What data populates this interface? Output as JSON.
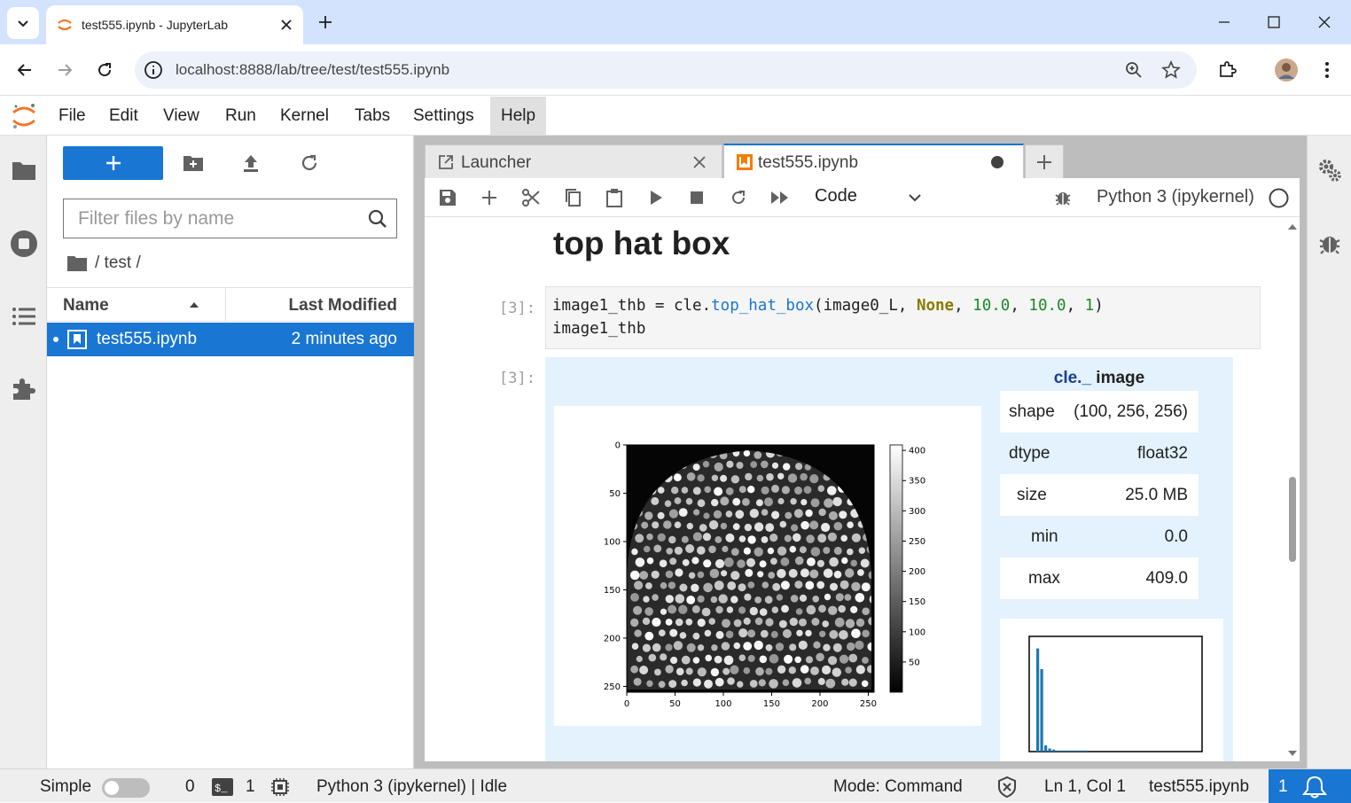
{
  "browser": {
    "tab_title": "test555.ipynb - JupyterLab",
    "url": "localhost:8888/lab/tree/test/test555.ipynb"
  },
  "menubar": {
    "items": [
      "File",
      "Edit",
      "View",
      "Run",
      "Kernel",
      "Tabs",
      "Settings",
      "Help"
    ],
    "active": "Help"
  },
  "filebrowser": {
    "filter_placeholder": "Filter files by name",
    "breadcrumb": "/ test /",
    "col_name": "Name",
    "col_modified": "Last Modified",
    "files": [
      {
        "name": "test555.ipynb",
        "modified": "2 minutes ago",
        "selected": true
      }
    ]
  },
  "dock": {
    "tabs": [
      {
        "label": "Launcher",
        "current": false
      },
      {
        "label": "test555.ipynb",
        "current": true
      }
    ]
  },
  "notebook": {
    "cell_type": "Code",
    "kernel": "Python 3 (ipykernel)",
    "heading": "top hat box",
    "input_prompt": "[3]:",
    "output_prompt": "[3]:",
    "code_line1": {
      "var": "image1_thb",
      "eq": " = ",
      "obj": "cle.",
      "fn": "top_hat_box",
      "open": "(image0_L, ",
      "kw": "None",
      "sep1": ", ",
      "n1": "10.0",
      "sep2": ", ",
      "n2": "10.0",
      "sep3": ", ",
      "n3": "1",
      "close": ")"
    },
    "code_line2": "image1_thb",
    "info_title_brand": "cle._",
    "info_title_rest": " image",
    "info": [
      {
        "key": "shape",
        "value": "(100, 256, 256)"
      },
      {
        "key": "dtype",
        "value": "float32"
      },
      {
        "key": "size",
        "value": "25.0 MB"
      },
      {
        "key": "min",
        "value": "0.0"
      },
      {
        "key": "max",
        "value": "409.0"
      }
    ]
  },
  "chart_data": [
    {
      "type": "heatmap",
      "title": "",
      "xlabel": "",
      "ylabel": "",
      "x_ticks": [
        0,
        50,
        100,
        150,
        200,
        250
      ],
      "y_ticks": [
        0,
        50,
        100,
        150,
        200,
        250
      ],
      "xlim": [
        0,
        256
      ],
      "ylim": [
        256,
        0
      ],
      "colormap": "gray",
      "colorbar_ticks": [
        50,
        100,
        150,
        200,
        250,
        300,
        350,
        400
      ],
      "colorbar_range": [
        0,
        409
      ]
    },
    {
      "type": "bar",
      "title": "",
      "values": [
        100,
        80,
        6,
        3,
        2,
        1,
        1,
        1,
        1,
        1,
        1,
        1,
        1
      ],
      "ylim": [
        0,
        110
      ]
    }
  ],
  "statusbar": {
    "mode_label": "Simple",
    "terminals": "0",
    "kernels": "1",
    "kernel_status": "Python 3 (ipykernel) | Idle",
    "mode": "Mode: Command",
    "cursor": "Ln 1, Col 1",
    "filename": "test555.ipynb",
    "notifications": "1"
  },
  "colors": {
    "accent": "#1976d2",
    "output_bg": "#e3f2fd",
    "browser_frame": "#d3e3fd"
  }
}
